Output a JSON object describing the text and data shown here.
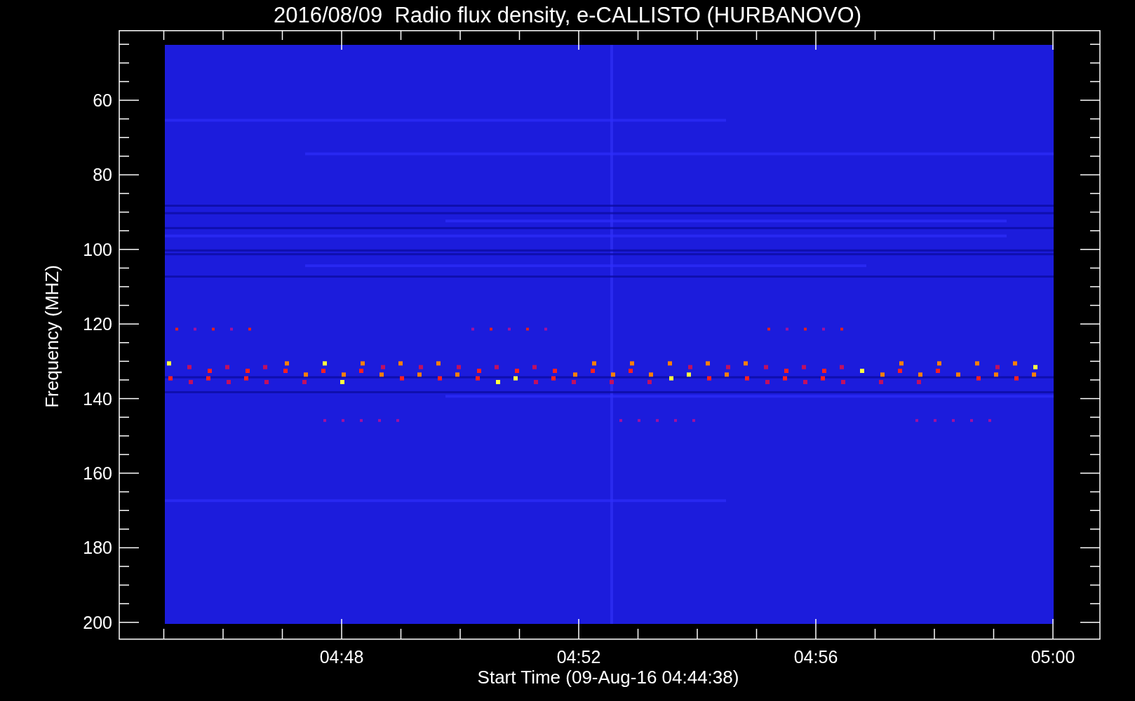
{
  "title": "2016/08/09  Radio flux density, e-CALLISTO (HURBANOVO)",
  "y_axis": {
    "label": "Frequency (MHZ)",
    "ticks": [
      "60",
      "80",
      "100",
      "120",
      "140",
      "160",
      "180",
      "200"
    ]
  },
  "x_axis": {
    "label": "Start Time (09-Aug-16 04:44:38)",
    "ticks": [
      "04:48",
      "04:52",
      "04:56",
      "05:00"
    ]
  }
}
